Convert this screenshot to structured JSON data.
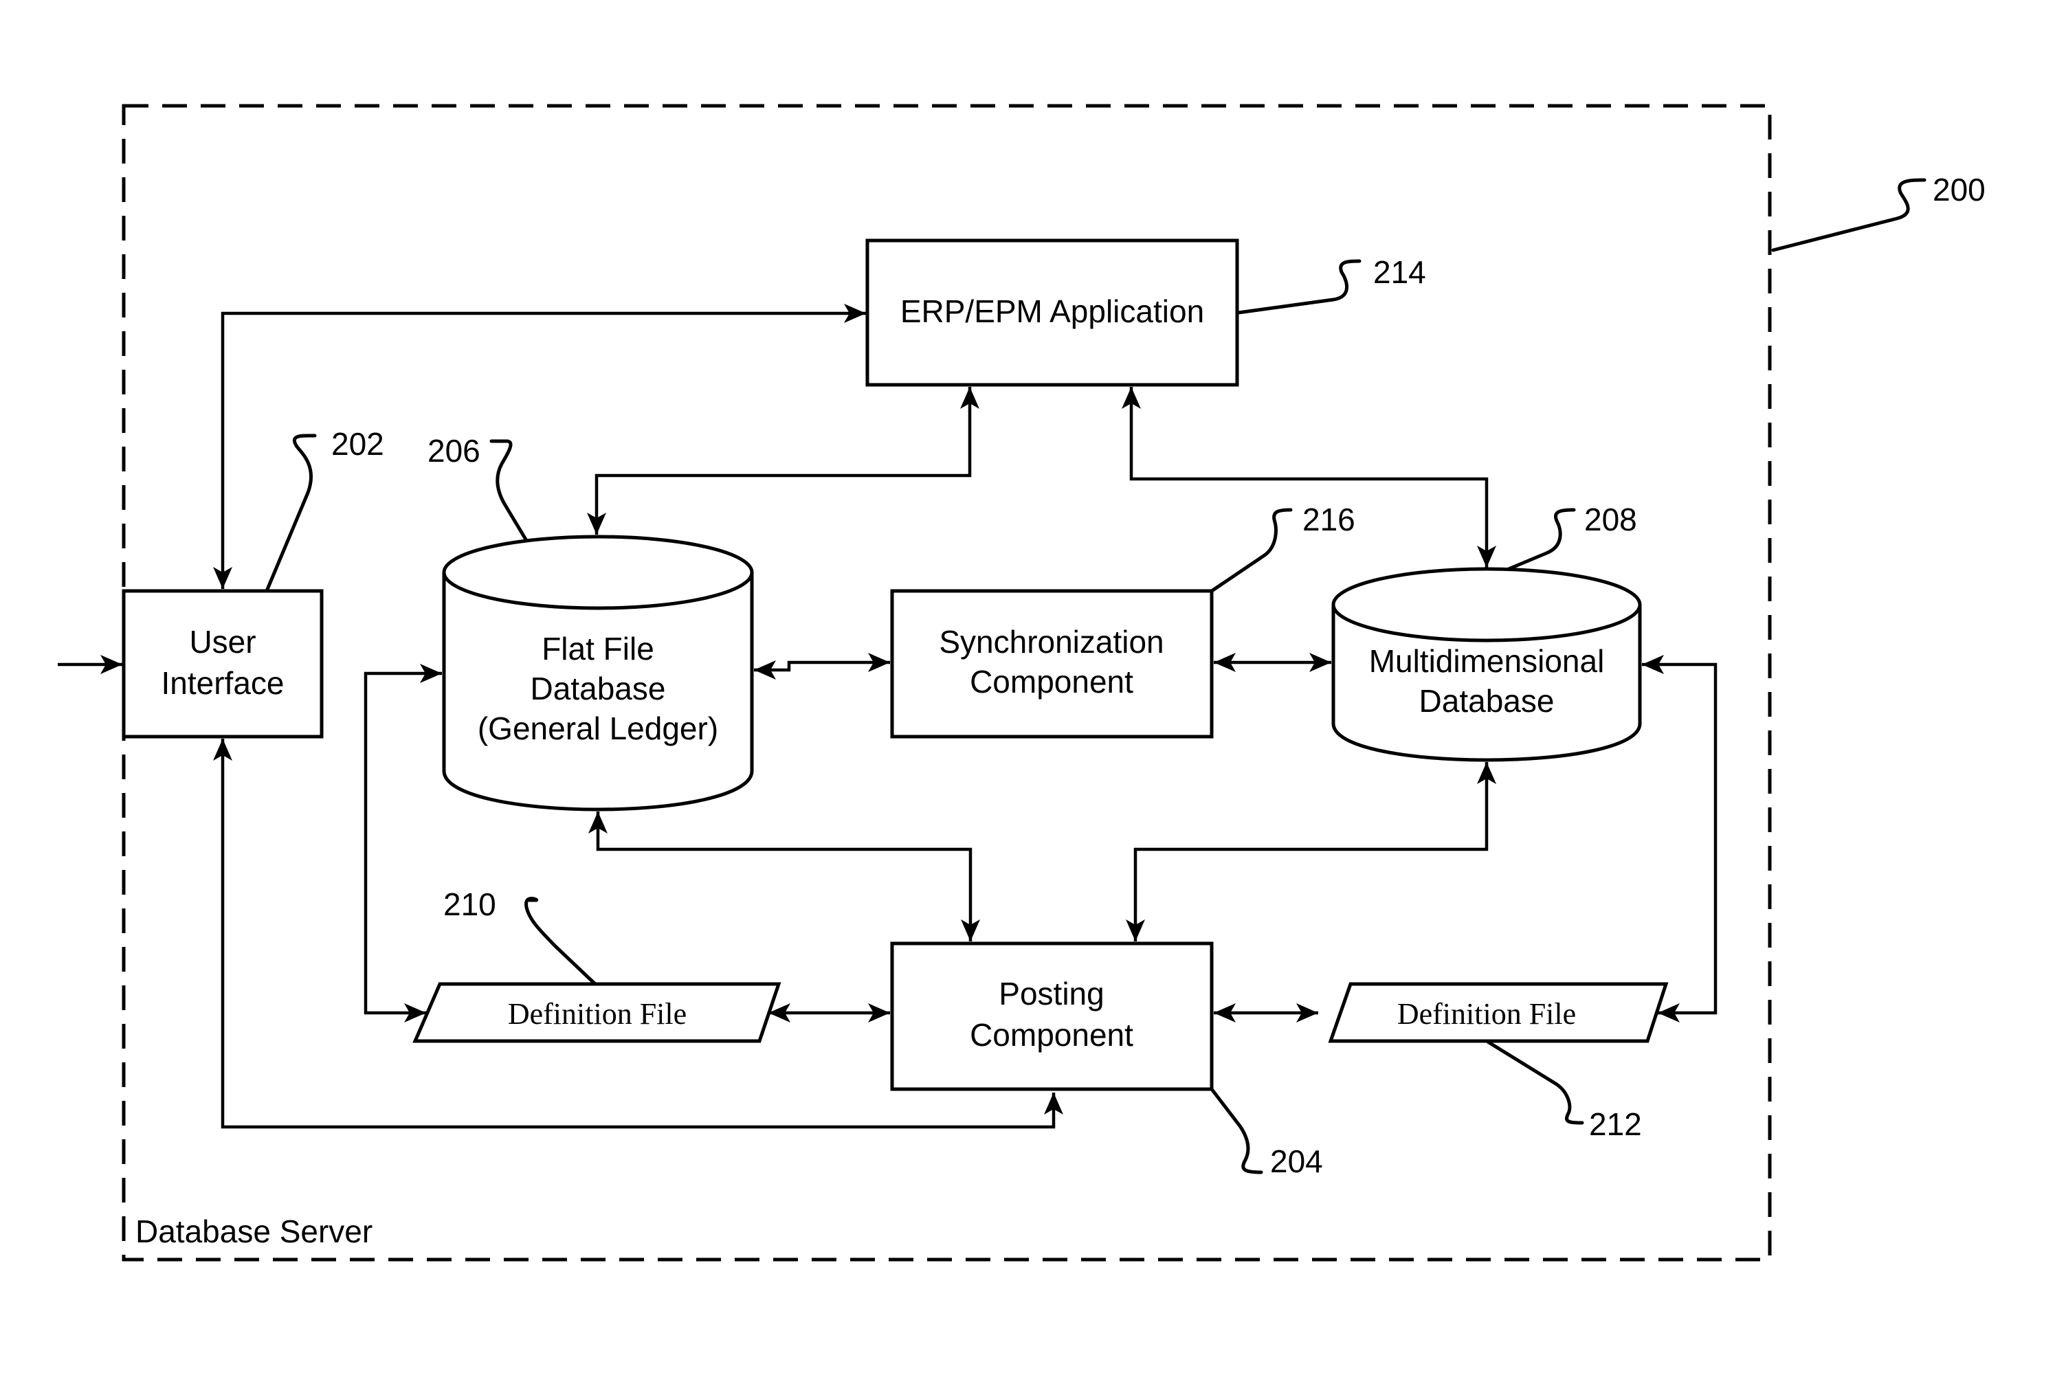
{
  "figure": {
    "ref": "200",
    "container_label": "Database Server"
  },
  "components": {
    "user_interface": {
      "ref": "202",
      "lines": [
        "User",
        "Interface"
      ]
    },
    "posting": {
      "ref": "204",
      "lines": [
        "Posting",
        "Component"
      ]
    },
    "flat_file_db": {
      "ref": "206",
      "lines": [
        "Flat File",
        "Database",
        "(General Ledger)"
      ]
    },
    "multidim_db": {
      "ref": "208",
      "lines": [
        "Multidimensional",
        "Database"
      ]
    },
    "definition_file_left": {
      "ref": "210",
      "label": "Definition File"
    },
    "definition_file_right": {
      "ref": "212",
      "label": "Definition File"
    },
    "erp_epm": {
      "ref": "214",
      "label": "ERP/EPM Application"
    },
    "synchronization": {
      "ref": "216",
      "lines": [
        "Synchronization",
        "Component"
      ]
    }
  },
  "connections": [
    {
      "from": "external-input",
      "to": "user_interface",
      "direction": "one-way"
    },
    {
      "from": "user_interface",
      "to": "erp_epm",
      "direction": "two-way"
    },
    {
      "from": "user_interface",
      "to": "posting",
      "direction": "two-way"
    },
    {
      "from": "flat_file_db",
      "to": "erp_epm",
      "direction": "two-way"
    },
    {
      "from": "multidim_db",
      "to": "erp_epm",
      "direction": "two-way"
    },
    {
      "from": "flat_file_db",
      "to": "synchronization",
      "direction": "two-way"
    },
    {
      "from": "synchronization",
      "to": "multidim_db",
      "direction": "two-way"
    },
    {
      "from": "flat_file_db",
      "to": "posting",
      "direction": "two-way"
    },
    {
      "from": "multidim_db",
      "to": "posting",
      "direction": "two-way"
    },
    {
      "from": "flat_file_db",
      "to": "definition_file_left",
      "direction": "two-way"
    },
    {
      "from": "definition_file_left",
      "to": "posting",
      "direction": "two-way"
    },
    {
      "from": "posting",
      "to": "definition_file_right",
      "direction": "two-way"
    },
    {
      "from": "definition_file_right",
      "to": "multidim_db",
      "direction": "two-way"
    }
  ]
}
